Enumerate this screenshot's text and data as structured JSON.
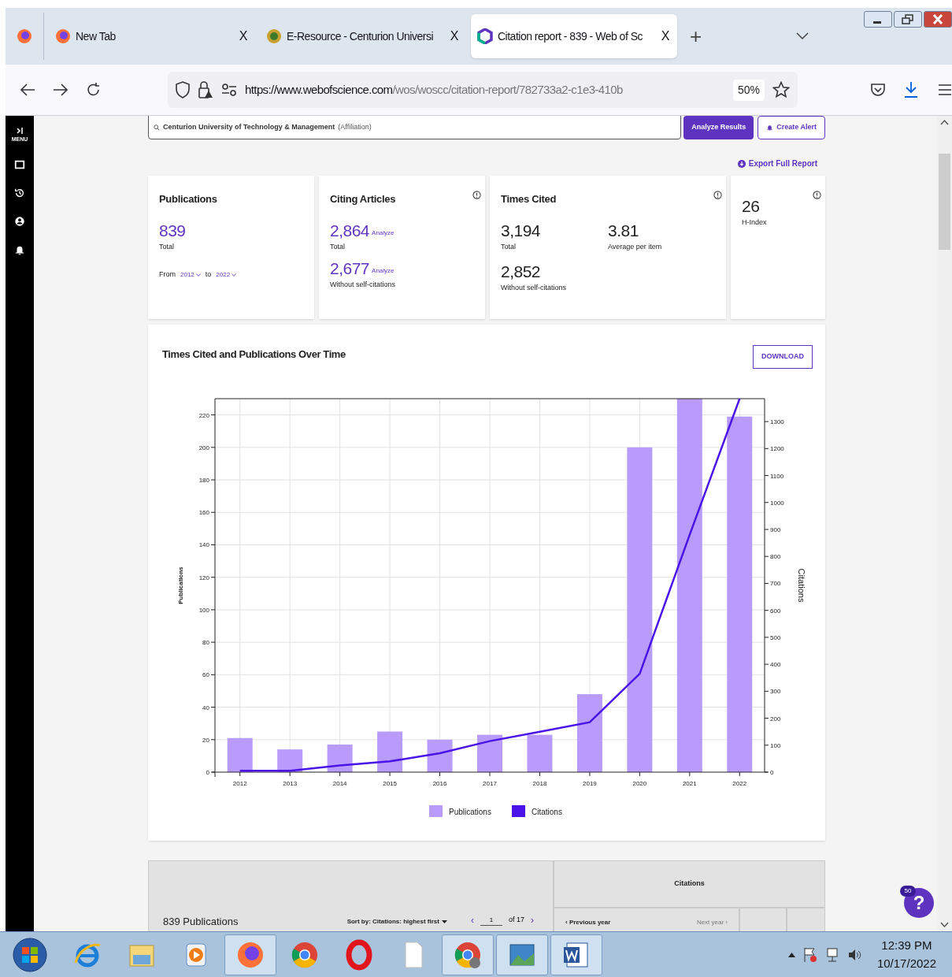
{
  "browser": {
    "tabs": [
      {
        "title": "New Tab",
        "close": "X",
        "selected": false
      },
      {
        "title": "E-Resource - Centurion Universi",
        "close": "X",
        "selected": false
      },
      {
        "title": "Citation report - 839 - Web of Sc",
        "close": "X",
        "selected": true
      }
    ],
    "new_tab": "+",
    "url_domain": "https://www.webofscience.com",
    "url_path": "/wos/woscc/citation-report/782733a2-c1e3-410b",
    "zoom": "50%"
  },
  "sidebar": {
    "label": "MENU"
  },
  "search": {
    "value": "Centurion University of Technology & Management",
    "qualifier": "(Affiliation)",
    "buttons": [
      {
        "label": "Analyze Results",
        "kind": "primary"
      },
      {
        "label": "Create Alert",
        "kind": "outline"
      }
    ]
  },
  "export_link": "Export Full Report",
  "summary_cards": [
    {
      "title": "Publications",
      "kind": "stack",
      "highlight": true,
      "info_icon": false,
      "metrics": [
        {
          "value": "839",
          "label": "Total"
        }
      ],
      "range": {
        "from_label": "From",
        "from": "2012",
        "to_label": "to",
        "to": "2022"
      }
    },
    {
      "title": "Citing Articles",
      "kind": "stack",
      "highlight": true,
      "info_icon": true,
      "metrics": [
        {
          "value": "2,864",
          "action": "Analyze",
          "label": "Total"
        },
        {
          "value": "2,677",
          "action": "Analyze",
          "label": "Without self-citations"
        }
      ]
    },
    {
      "title": "Times Cited",
      "kind": "grid",
      "highlight": false,
      "info_icon": true,
      "metrics": [
        {
          "value": "3,194",
          "label": "Total"
        },
        {
          "value": "3.81",
          "label": "Average per item"
        },
        {
          "value": "2,852",
          "label": "Without self-citations"
        }
      ]
    },
    {
      "kind": "compact",
      "highlight": false,
      "info_icon": true,
      "metrics": [
        {
          "value": "26",
          "label": "H-Index"
        }
      ]
    }
  ],
  "chart_card": {
    "title": "Times Cited and Publications Over Time",
    "download": "DOWNLOAD",
    "publications_chart": {
      "chart_data": {
        "type": "bar",
        "ylabel": "Publications",
        "categories": [
          "2012",
          "2013",
          "2014",
          "2015",
          "2016",
          "2017",
          "2018",
          "2019",
          "2020",
          "2021",
          "2022"
        ],
        "ylim": [
          0,
          230
        ],
        "yticks": [
          0,
          20,
          40,
          60,
          80,
          100,
          120,
          140,
          160,
          180,
          200,
          220
        ],
        "grid": true,
        "series": [
          {
            "name": "Publications",
            "color": "#b89bfb",
            "values": [
              21,
              14,
              17,
              25,
              20,
              23,
              23,
              48,
              200,
              230,
              219
            ]
          }
        ]
      }
    },
    "citations_chart": {
      "chart_data": {
        "type": "line",
        "ylabel": "Citations",
        "ylim": [
          0,
          1385
        ],
        "yticks": [
          0,
          100,
          200,
          300,
          400,
          500,
          600,
          700,
          800,
          900,
          1000,
          1100,
          1200,
          1300
        ],
        "series": [
          {
            "name": "Citations",
            "color": "#4a14e8",
            "values": [
              5,
              5,
              25,
              40,
              70,
              115,
              150,
              185,
              365,
              880,
              1385
            ]
          }
        ]
      }
    }
  },
  "results_table": {
    "count": "839 Publications",
    "sort": "Sort by: Citations: highest first",
    "prev_page": "‹",
    "page": "1",
    "of_pages": "of 17",
    "next_page": "›",
    "citations_header": "Citations",
    "previous_year": "‹ Previous year",
    "next_year": "Next year ›"
  },
  "help": {
    "badge": "50",
    "label": "?"
  },
  "taskbar": {
    "apps": [
      {
        "active": false
      },
      {
        "active": false
      },
      {
        "active": false
      },
      {
        "active": true
      },
      {
        "active": false
      },
      {
        "active": false
      },
      {
        "active": false
      },
      {
        "active": true
      },
      {
        "active": true
      },
      {
        "active": true
      }
    ],
    "time": "12:39 PM",
    "date": "10/17/2022"
  }
}
